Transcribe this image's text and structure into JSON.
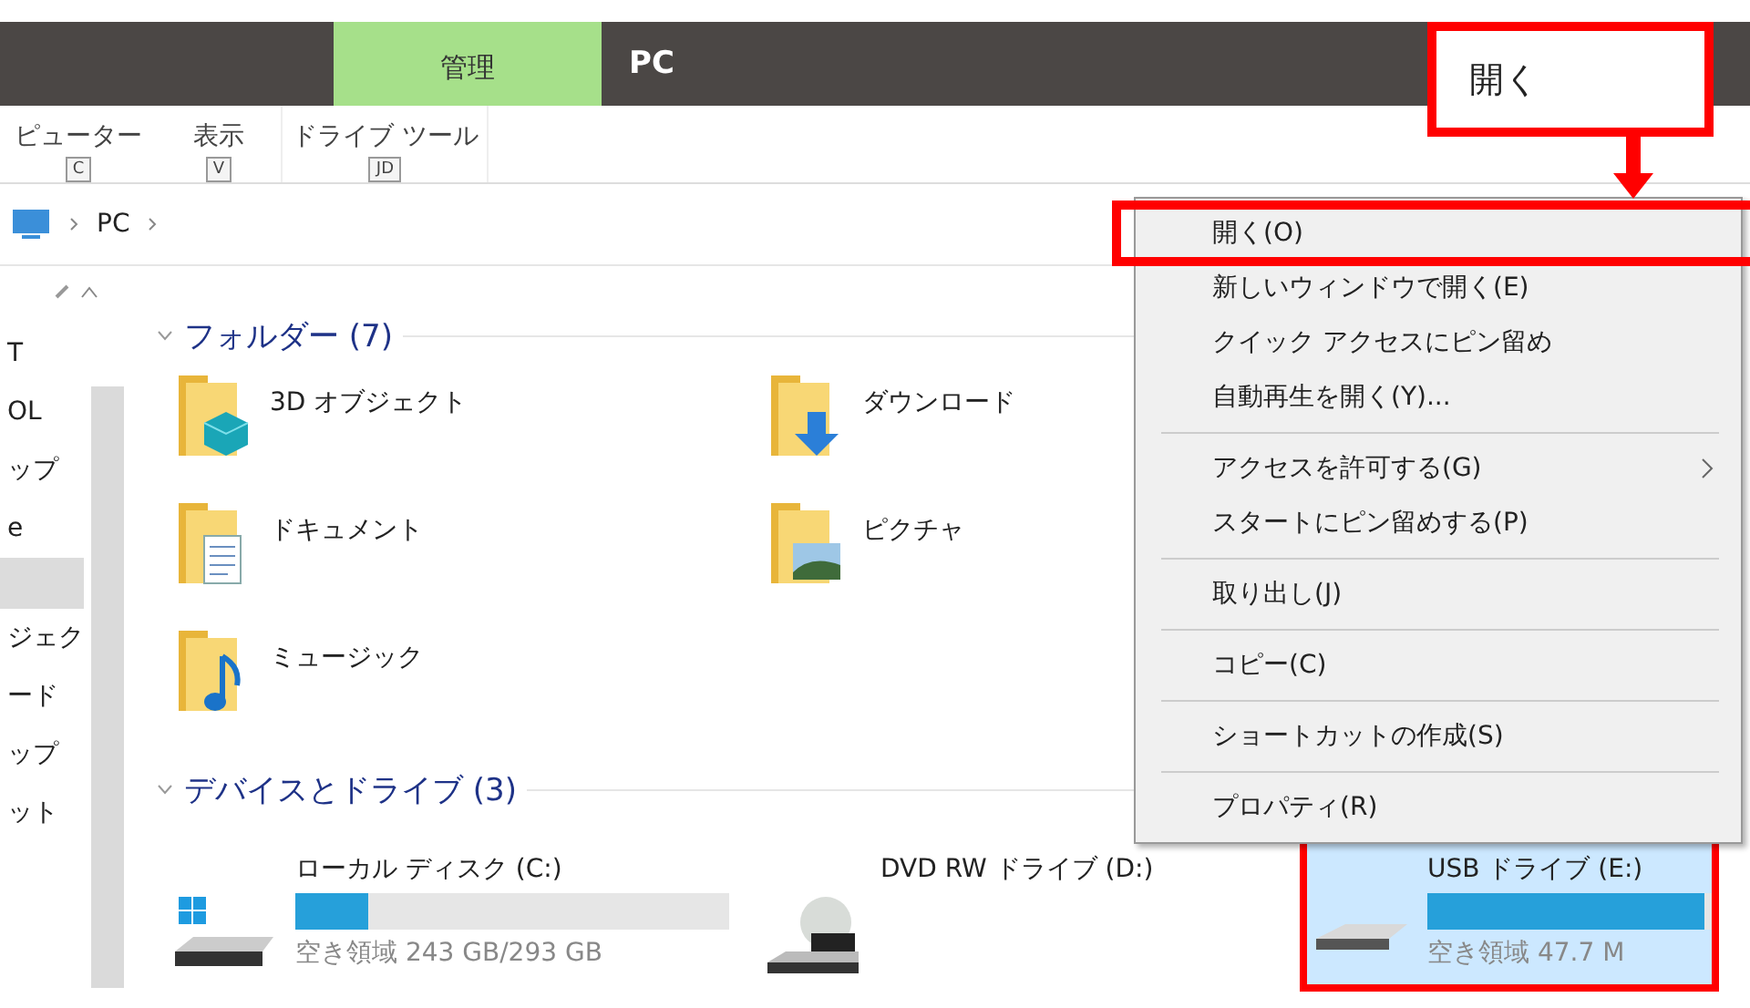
{
  "title_bar": {
    "tab_group": {
      "label": "管理",
      "selected": true
    },
    "title": "PC"
  },
  "ribbon": {
    "tabs": [
      {
        "label": "ピューター",
        "key_tip": "C"
      },
      {
        "label": "表示",
        "key_tip": "V"
      },
      {
        "label": "ドライブ ツール",
        "key_tip": "JD"
      }
    ]
  },
  "address_bar": {
    "path": [
      "PC"
    ]
  },
  "navigation": {
    "items": [
      {
        "label": "T",
        "selected": false
      },
      {
        "label": "OL",
        "selected": false
      },
      {
        "label": "ップ",
        "selected": false
      },
      {
        "label": "e",
        "selected": false
      },
      {
        "selected": true
      },
      {
        "label": "ジェク",
        "selected": false
      },
      {
        "label": "ード",
        "selected": false
      },
      {
        "label": "ップ",
        "selected": false
      },
      {
        "label": "ット",
        "selected": false
      }
    ]
  },
  "folders": {
    "title": "フォルダー (7)",
    "items": [
      {
        "name": "3D オブジェクト",
        "kind": "objects"
      },
      {
        "name": "ダウンロード",
        "kind": "downloads"
      },
      {
        "name": "ドキュメント",
        "kind": "documents"
      },
      {
        "name": "ピクチャ",
        "kind": "pictures"
      },
      {
        "name": "ミュージック",
        "kind": "music"
      }
    ]
  },
  "drives": {
    "title": "デバイスとドライブ (3)",
    "items": [
      {
        "name": "ローカル ディスク (C:)",
        "kind": "system",
        "level": 0.17,
        "free": "空き領域 243 GB/293 GB",
        "selected": false,
        "marked": false
      },
      {
        "name": "DVD RW ドライブ (D:)",
        "kind": "dvd",
        "selected": false,
        "marked": false
      },
      {
        "name": "USB ドライブ (E:)",
        "kind": "usb",
        "level": 0.95,
        "free": "空き領域 47.7 M",
        "selected": true,
        "marked": true
      }
    ]
  },
  "context_menu": {
    "groups": [
      [
        {
          "label": "開く(O)",
          "marked": true
        },
        {
          "label": "新しいウィンドウで開く(E)",
          "marked": false
        },
        {
          "label": "クイック アクセスにピン留め",
          "marked": false
        },
        {
          "label": "自動再生を開く(Y)...",
          "marked": false
        }
      ],
      [
        {
          "label": "アクセスを許可する(G)",
          "submenu": true,
          "marked": false
        },
        {
          "label": "スタートにピン留めする(P)",
          "marked": false
        }
      ],
      [
        {
          "label": "取り出し(J)",
          "marked": false
        }
      ],
      [
        {
          "label": "コピー(C)",
          "marked": false
        }
      ],
      [
        {
          "label": "ショートカットの作成(S)",
          "marked": false
        }
      ],
      [
        {
          "label": "プロパティ(R)",
          "marked": false
        }
      ]
    ]
  },
  "callout": {
    "label": "開く"
  }
}
